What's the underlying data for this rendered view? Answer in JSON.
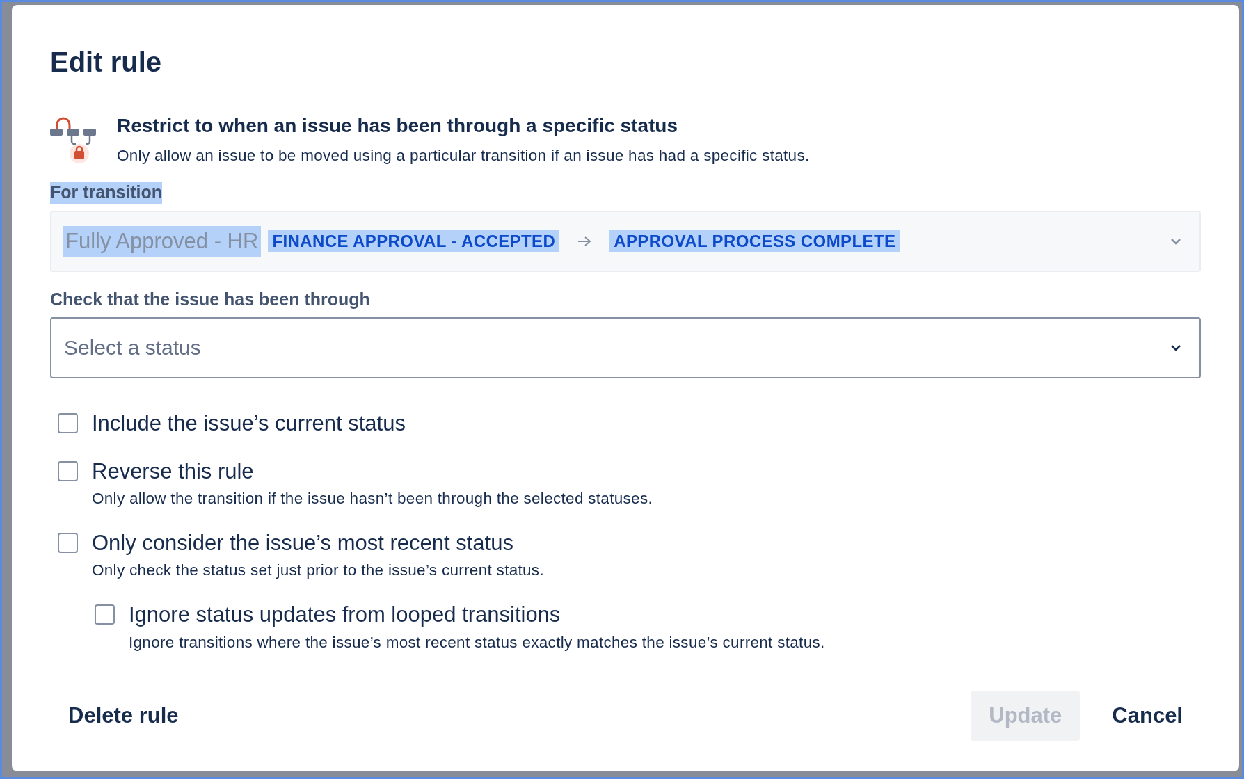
{
  "dialog": {
    "title": "Edit rule",
    "rule": {
      "heading": "Restrict to when an issue has been through a specific status",
      "description": "Only allow an issue to be moved using a particular transition if an issue has had a specific status."
    },
    "transition_field": {
      "label": "For transition",
      "highlighted": true,
      "value": {
        "from_workflow": "Fully Approved - HR",
        "from_status": "FINANCE APPROVAL - ACCEPTED",
        "to_status": "APPROVAL PROCESS COMPLETE",
        "highlighted": true
      }
    },
    "status_field": {
      "label": "Check that the issue has been through",
      "placeholder": "Select a status"
    },
    "options": [
      {
        "label": "Include the issue’s current status",
        "checked": false
      },
      {
        "label": "Reverse this rule",
        "description": "Only allow the transition if the issue hasn’t been through the selected statuses.",
        "checked": false
      },
      {
        "label": "Only consider the issue’s most recent status",
        "description": "Only check the status set just prior to the issue’s current status.",
        "checked": false,
        "children": [
          {
            "label": "Ignore status updates from looped transitions",
            "description": "Ignore transitions where the issue’s most recent status exactly matches the issue’s current status.",
            "checked": false
          }
        ]
      }
    ],
    "buttons": {
      "delete": {
        "label": "Delete rule"
      },
      "update": {
        "label": "Update",
        "disabled": true
      },
      "cancel": {
        "label": "Cancel"
      }
    }
  }
}
